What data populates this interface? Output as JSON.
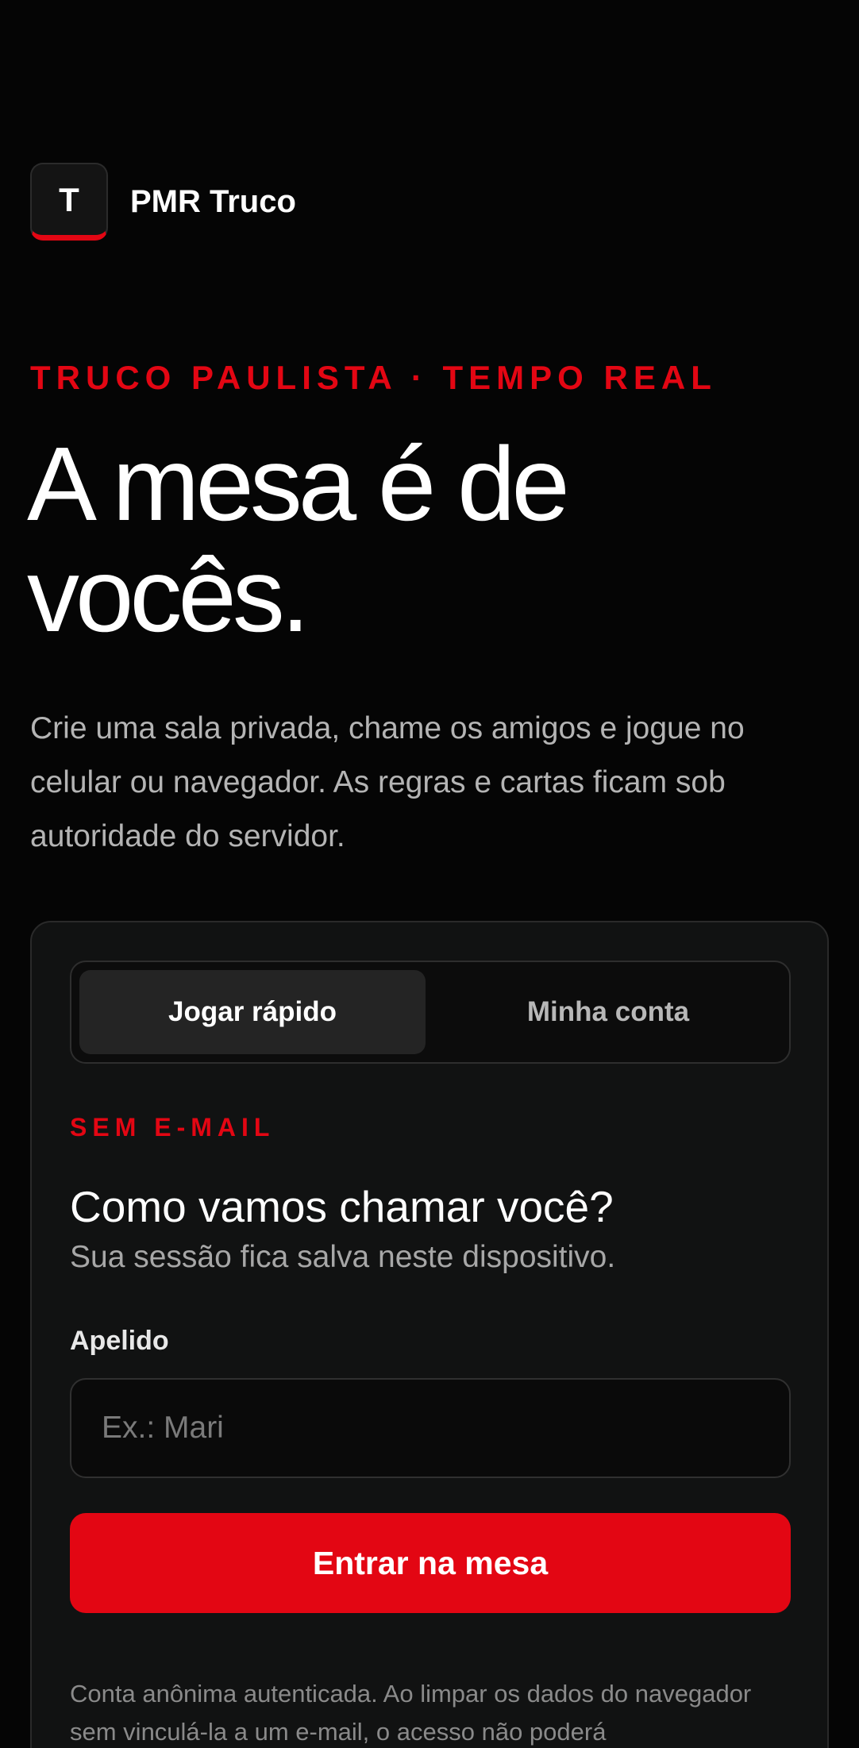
{
  "brand": {
    "logo_letter": "T",
    "name": "PMR Truco"
  },
  "hero": {
    "eyebrow": "TRUCO PAULISTA · TEMPO REAL",
    "headline": "A mesa é de vocês.",
    "lead": "Crie uma sala privada, chame os amigos e jogue no celular ou navegador. As regras e cartas ficam sob autoridade do servidor."
  },
  "card": {
    "tabs": [
      {
        "label": "Jogar rápido",
        "active": true
      },
      {
        "label": "Minha conta",
        "active": false
      }
    ],
    "section_tag": "SEM E-MAIL",
    "question": "Como vamos chamar você?",
    "subtitle": "Sua sessão fica salva neste dispositivo.",
    "field_label": "Apelido",
    "input_value": "",
    "input_placeholder": "Ex.: Mari",
    "cta_label": "Entrar na mesa",
    "note": "Conta anônima autenticada. Ao limpar os dados do navegador sem vinculá-la a um e-mail, o acesso não poderá"
  },
  "colors": {
    "accent": "#e30613",
    "background": "#050505",
    "card": "#111212"
  }
}
